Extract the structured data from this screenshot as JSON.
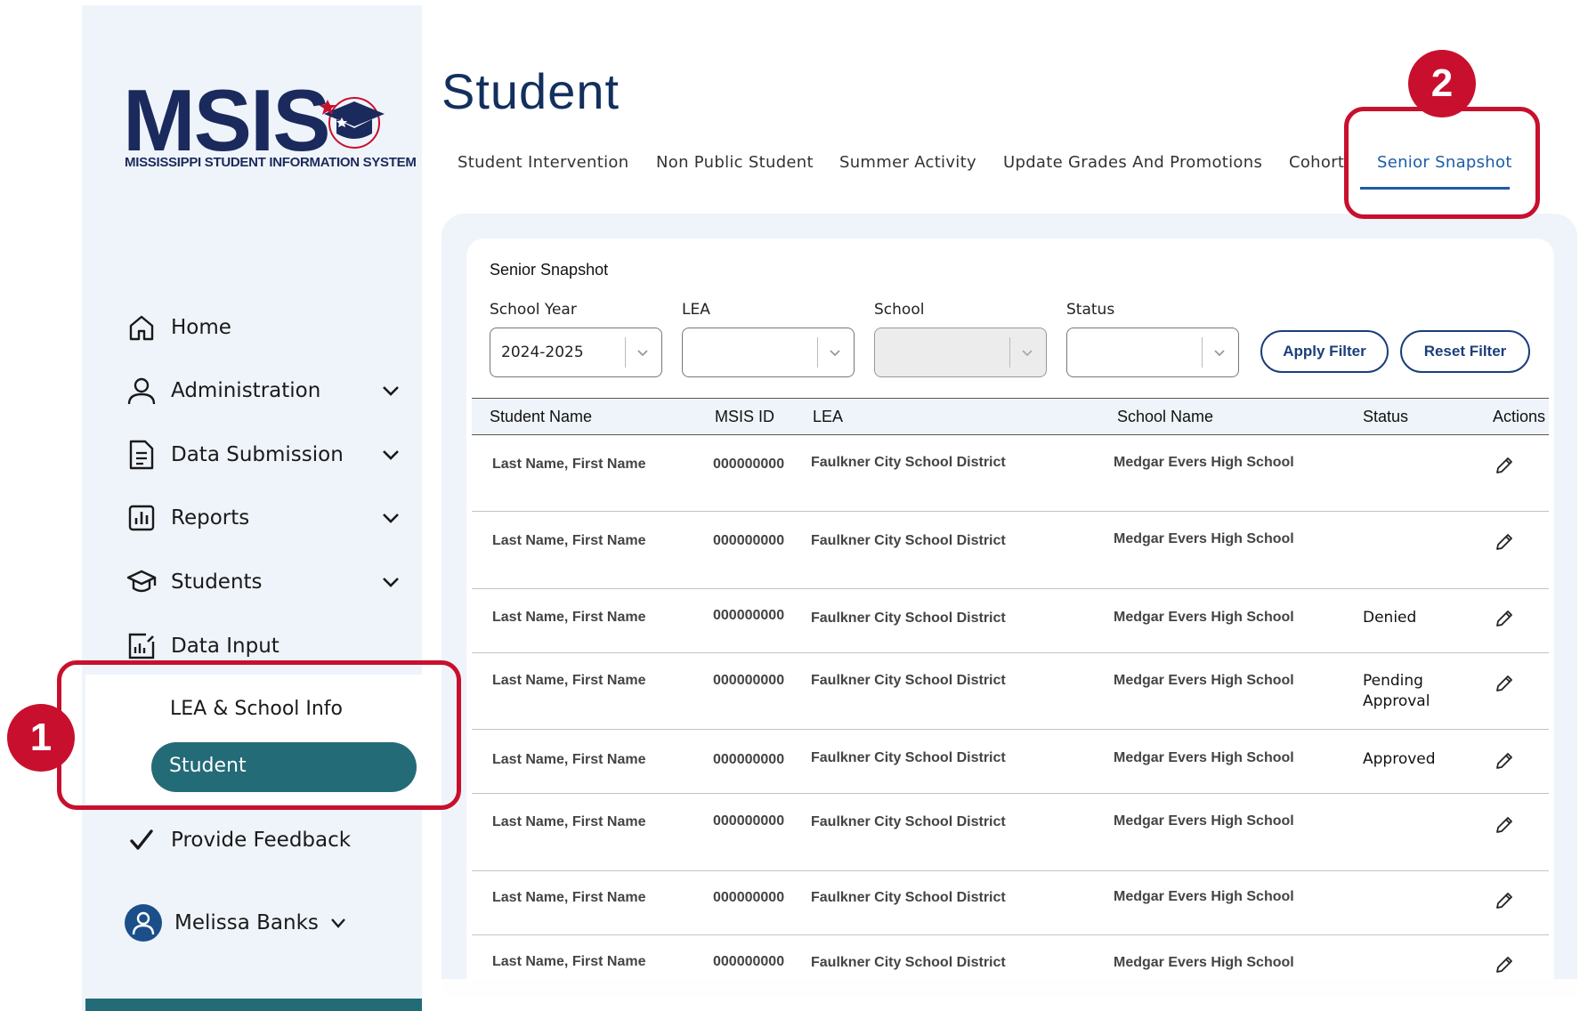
{
  "logo": {
    "word": "MSIS",
    "tagline": "MISSISSIPPI STUDENT INFORMATION SYSTEM"
  },
  "nav": {
    "home": "Home",
    "administration": "Administration",
    "data_submission": "Data Submission",
    "reports": "Reports",
    "students": "Students",
    "data_input": "Data Input",
    "sub_lea_school_info": "LEA & School Info",
    "sub_student": "Student",
    "provide_feedback": "Provide Feedback"
  },
  "user": {
    "name": "Melissa Banks"
  },
  "page": {
    "title": "Student"
  },
  "tabs": [
    "Student Intervention",
    "Non Public Student",
    "Summer Activity",
    "Update Grades And Promotions",
    "Cohort",
    "Senior Snapshot"
  ],
  "panel": {
    "title": "Senior Snapshot"
  },
  "filters": {
    "school_year_label": "School Year",
    "school_year_value": "2024-2025",
    "lea_label": "LEA",
    "lea_value": "",
    "school_label": "School",
    "school_value": "",
    "status_label": "Status",
    "status_value": "",
    "apply_label": "Apply Filter",
    "reset_label": "Reset Filter"
  },
  "table": {
    "columns": [
      "Student Name",
      "MSIS ID",
      "LEA",
      "School Name",
      "Status",
      "Actions"
    ],
    "rows": [
      {
        "name": "Last Name, First Name",
        "id": "000000000",
        "lea": "Faulkner City School District",
        "school": "Medgar Evers High School",
        "status": ""
      },
      {
        "name": "Last Name, First Name",
        "id": "000000000",
        "lea": "Faulkner City School District",
        "school": "Medgar Evers High School",
        "status": ""
      },
      {
        "name": "Last Name, First Name",
        "id": "000000000",
        "lea": "Faulkner City School District",
        "school": "Medgar Evers High School",
        "status": "Denied"
      },
      {
        "name": "Last Name, First Name",
        "id": "000000000",
        "lea": "Faulkner City School District",
        "school": "Medgar Evers High School",
        "status": "Pending Approval"
      },
      {
        "name": "Last Name, First Name",
        "id": "000000000",
        "lea": "Faulkner City School District",
        "school": "Medgar Evers High School",
        "status": "Approved"
      },
      {
        "name": "Last Name, First Name",
        "id": "000000000",
        "lea": "Faulkner City School District",
        "school": "Medgar Evers High School",
        "status": ""
      },
      {
        "name": "Last Name, First Name",
        "id": "000000000",
        "lea": "Faulkner City School District",
        "school": "Medgar Evers High School",
        "status": ""
      },
      {
        "name": "Last Name, First Name",
        "id": "000000000",
        "lea": "Faulkner City School District",
        "school": "Medgar Evers High School",
        "status": ""
      }
    ]
  },
  "annotations": {
    "badge_1": "1",
    "badge_2": "2"
  },
  "colors": {
    "accent": "#246b78",
    "brand_navy": "#1b2a5c",
    "link_blue": "#1d5ca8",
    "callout_red": "#c8102e"
  },
  "icons": {
    "home": "home-icon",
    "administration": "person-icon",
    "data_submission": "document-icon",
    "reports": "bar-chart-icon",
    "students": "graduation-cap-icon",
    "data_input": "chart-edit-icon",
    "provide_feedback": "checkmark-icon",
    "edit": "pencil-icon"
  }
}
